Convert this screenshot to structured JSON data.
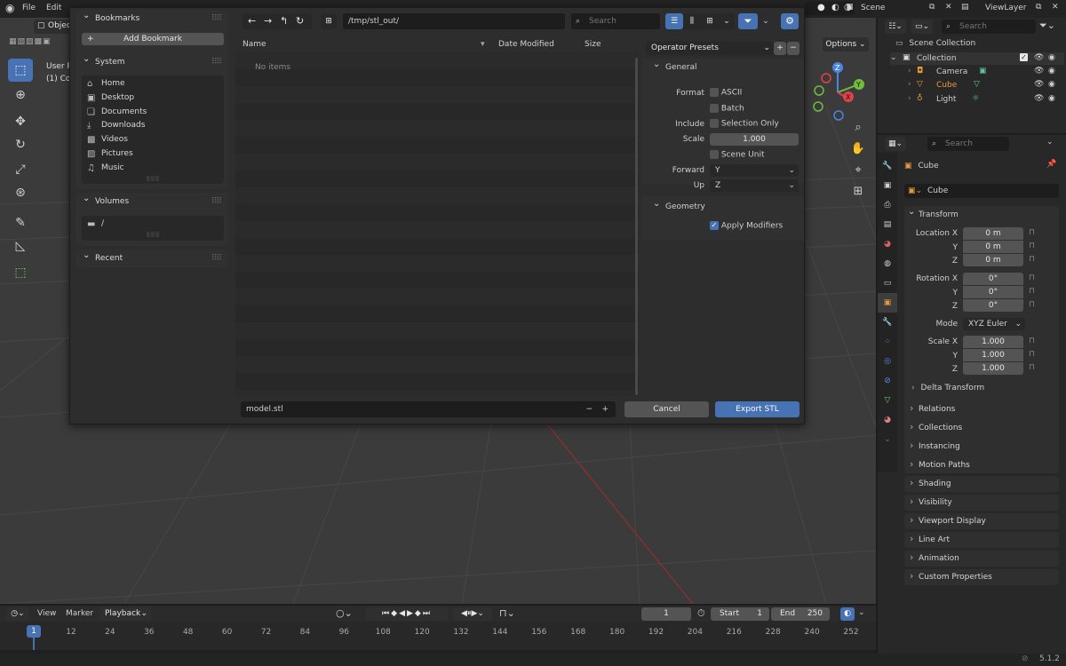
{
  "topbar": {
    "menu": [
      "File",
      "Edit"
    ],
    "scene": "Scene",
    "view_layer": "ViewLayer"
  },
  "viewport": {
    "mode": "Objec",
    "info_line1": "User P",
    "info_line2": "(1) Col"
  },
  "dialog": {
    "bookmarks": {
      "title": "Bookmarks",
      "add_button": "Add Bookmark"
    },
    "system": {
      "title": "System",
      "items": [
        "Home",
        "Desktop",
        "Documents",
        "Downloads",
        "Videos",
        "Pictures",
        "Music"
      ]
    },
    "volumes": {
      "title": "Volumes",
      "items": [
        "/"
      ]
    },
    "recent": {
      "title": "Recent"
    },
    "path": "/tmp/stl_out/",
    "search_placeholder": "Search",
    "columns": {
      "name": "Name",
      "date": "Date Modified",
      "size": "Size"
    },
    "empty_text": "No items",
    "filename": "model.stl",
    "cancel_label": "Cancel",
    "export_label": "Export STL",
    "options_label": "Options",
    "operator_presets": "Operator Presets",
    "general": {
      "title": "General",
      "format_label": "Format",
      "ascii_label": "ASCII",
      "batch_label": "Batch",
      "include_label": "Include",
      "selection_only_label": "Selection Only",
      "scale_label": "Scale",
      "scale_value": "1.000",
      "scene_unit_label": "Scene Unit",
      "forward_label": "Forward",
      "forward_value": "Y",
      "up_label": "Up",
      "up_value": "Z"
    },
    "geometry": {
      "title": "Geometry",
      "apply_modifiers_label": "Apply Modifiers"
    }
  },
  "outliner": {
    "search_placeholder": "Search",
    "scene_collection": "Scene Collection",
    "collection": "Collection",
    "items": [
      "Camera",
      "Cube",
      "Light"
    ]
  },
  "properties": {
    "search_placeholder": "Search",
    "object_name": "Cube",
    "object_field": "Cube",
    "transform": {
      "title": "Transform",
      "location_x_label": "Location X",
      "y_label": "Y",
      "z_label": "Z",
      "location": [
        "0 m",
        "0 m",
        "0 m"
      ],
      "rotation_x_label": "Rotation X",
      "rotation": [
        "0°",
        "0°",
        "0°"
      ],
      "mode_label": "Mode",
      "mode_value": "XYZ Euler",
      "scale_x_label": "Scale X",
      "scale": [
        "1.000",
        "1.000",
        "1.000"
      ],
      "delta_transform": "Delta Transform"
    },
    "sections": [
      "Relations",
      "Collections",
      "Instancing",
      "Motion Paths",
      "Shading",
      "Visibility",
      "Viewport Display",
      "Line Art",
      "Animation",
      "Custom Properties"
    ]
  },
  "timeline": {
    "view_label": "View",
    "marker_label": "Marker",
    "playback_label": "Playback",
    "current_frame": "1",
    "start_label": "Start",
    "start_value": "1",
    "end_label": "End",
    "end_value": "250",
    "ruler": [
      "12",
      "24",
      "36",
      "48",
      "60",
      "72",
      "84",
      "96",
      "108",
      "120",
      "132",
      "144",
      "156",
      "168",
      "180",
      "192",
      "204",
      "216",
      "228",
      "240",
      "252"
    ],
    "playhead": "1"
  },
  "statusbar": {
    "version": "5.1.2"
  },
  "colors": {
    "accent": "#4772b3",
    "selected_object": "#e69a3a",
    "x_axis": "#c83a3a"
  }
}
